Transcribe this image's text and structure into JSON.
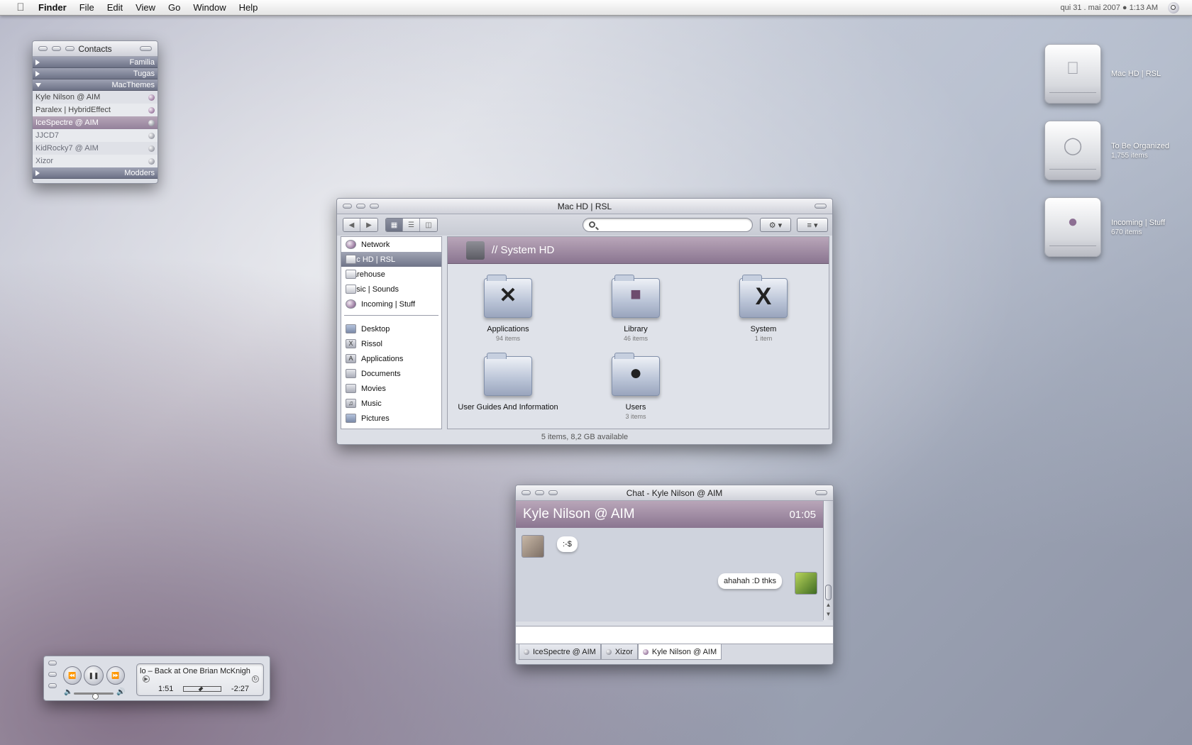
{
  "menubar": {
    "app": "Finder",
    "items": [
      "File",
      "Edit",
      "View",
      "Go",
      "Window",
      "Help"
    ],
    "clock": "qui 31 . mai 2007 ● 1:13 AM"
  },
  "contacts": {
    "title": "Contacts",
    "groups": {
      "familia": "Familia",
      "tugas": "Tugas",
      "macthemes": "MacThemes",
      "modders": "Modders"
    },
    "buddies": [
      {
        "name": "Kyle Nilson @ AIM",
        "status": "available"
      },
      {
        "name": "Paralex | HybridEffect",
        "status": "available"
      },
      {
        "name": "IceSpectre @ AIM",
        "status": "selected"
      },
      {
        "name": "JJCD7",
        "status": "away"
      },
      {
        "name": "KidRocky7 @ AIM",
        "status": "away"
      },
      {
        "name": "Xizor",
        "status": "away"
      }
    ]
  },
  "desktop": {
    "drives": [
      {
        "label": "Mac HD | RSL",
        "sub": ""
      },
      {
        "label": "To Be Organized",
        "sub": "1,755 items"
      },
      {
        "label": "Incoming | Stuff",
        "sub": "670 items"
      }
    ]
  },
  "finder": {
    "title": "Mac HD | RSL",
    "path": "// System HD",
    "sidebar": {
      "devices": [
        "Network",
        "Mac HD | RSL",
        "Warehouse",
        "Music | Sounds",
        "Incoming | Stuff"
      ],
      "places": [
        "Desktop",
        "Rissol",
        "Applications",
        "Documents",
        "Movies",
        "Music",
        "Pictures"
      ]
    },
    "items": [
      {
        "name": "Applications",
        "count": "94 items"
      },
      {
        "name": "Library",
        "count": "46 items"
      },
      {
        "name": "System",
        "count": "1 item"
      },
      {
        "name": "User Guides And Information",
        "count": ""
      },
      {
        "name": "Users",
        "count": "3 items"
      }
    ],
    "status": "5 items, 8,2 GB available"
  },
  "chat": {
    "title": "Chat - Kyle Nilson @ AIM",
    "buddy": "Kyle Nilson @ AIM",
    "time": "01:05",
    "messages": [
      {
        "from": "them",
        "text": ":-$"
      },
      {
        "from": "me",
        "text": "ahahah :D thks"
      }
    ],
    "tabs": [
      "IceSpectre @ AIM",
      "Xizor",
      "Kyle Nilson @ AIM"
    ]
  },
  "itunes": {
    "track": "lo – Back at One   Brian McKnigh",
    "elapsed": "1:51",
    "remaining": "-2:27",
    "progress": 0.43,
    "volume": 0.55
  },
  "colors": {
    "accent": "#8a7590",
    "selection": "#6f7488"
  }
}
